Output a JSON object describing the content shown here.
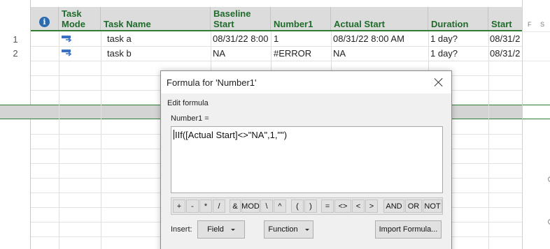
{
  "columns": {
    "info_symbol": "i",
    "task_mode_line1": "Task",
    "task_mode_line2": "Mode",
    "task_name": "Task Name",
    "baseline_start": "Baseline Start",
    "number1": "Number1",
    "actual_start": "Actual Start",
    "duration": "Duration",
    "start": "Start"
  },
  "rows": [
    {
      "num": "1",
      "task_name": "task a",
      "baseline_start": "08/31/22 8:00",
      "number1": "1",
      "actual_start": "08/31/22 8:00 AM",
      "duration": "1 day?",
      "start": "08/31/2"
    },
    {
      "num": "2",
      "task_name": "task b",
      "baseline_start": "NA",
      "number1": "#ERROR",
      "actual_start": "NA",
      "duration": "1 day?",
      "start": "08/31/2"
    }
  ],
  "gutter_header": "F S",
  "dialog": {
    "title": "Formula for 'Number1'",
    "edit_formula_label": "Edit formula",
    "field_label": "Number1 =",
    "formula": "IIf([Actual Start]<>\"NA\",1,\"\")",
    "operators": [
      "+",
      "-",
      "*",
      "/",
      "&",
      "MOD",
      "\\",
      "^",
      "(",
      ")",
      "=",
      "<>",
      "<",
      ">",
      "AND",
      "OR",
      "NOT"
    ],
    "insert_label": "Insert:",
    "field_button": "Field",
    "function_button": "Function",
    "import_button": "Import Formula..."
  },
  "colors": {
    "header_text": "#1e6b2a",
    "header_underline": "#2e7d32",
    "info_icon": "#2b6cb0",
    "task_icon": "#3a6fc4"
  }
}
